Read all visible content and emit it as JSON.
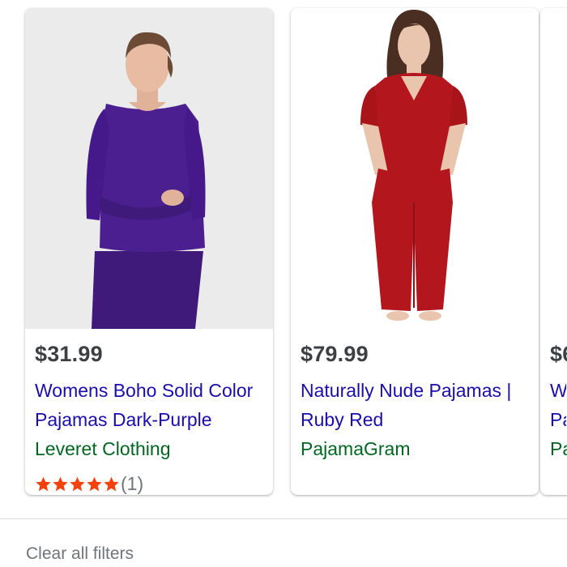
{
  "products": [
    {
      "price": "$31.99",
      "title": "Womens Boho Solid Color Pajamas Dark-Purple",
      "seller": "Leveret Clothing",
      "rating_stars": 5,
      "rating_count": "(1)",
      "image": "woman-purple-long-sleeve-pajamas",
      "pajama_color": "#4b1f8f"
    },
    {
      "price": "$79.99",
      "title": "Naturally Nude Pajamas | Ruby Red",
      "seller": "PajamaGram",
      "image": "woman-red-short-sleeve-pajamas",
      "pajama_color": "#b3161d"
    },
    {
      "price": "$6",
      "title": "W Pa",
      "seller": "Pa"
    }
  ],
  "footer": {
    "clear_filters": "Clear all filters"
  },
  "colors": {
    "price": "#3c4043",
    "title_link": "#1a0dab",
    "seller": "#006621",
    "star": "#f5410c",
    "muted": "#70757a"
  }
}
